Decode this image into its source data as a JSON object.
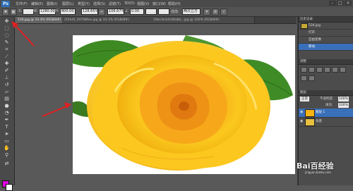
{
  "app": {
    "logo_text": "Ps"
  },
  "menubar": {
    "items": [
      "文件(F)",
      "编辑(E)",
      "图像(I)",
      "图层(L)",
      "类型(Y)",
      "选择(S)",
      "滤镜(T)",
      "3D(D)",
      "视图(V)",
      "窗口(W)",
      "帮助(H)"
    ],
    "window_controls": [
      "–",
      "□",
      "×"
    ]
  },
  "options_bar": {
    "width_label": "W:",
    "width_value": "1280.00",
    "height_label": "H:",
    "height_value": "800.00",
    "scale_x": "128.65%",
    "scale_y": "106.67%",
    "angle": "0.00",
    "interp_label": "插值:",
    "interp_value": "两次立方"
  },
  "tabs": [
    {
      "label": "534.jpg @ 33.3% (RGB/8#)",
      "active": true
    },
    {
      "label": "2t5hd1.29798fee.jpg @ 33.3% (RGB/8#)",
      "active": false
    },
    {
      "label": "19bc3e1d1d6a8a...jpg @ 100% (RGB/8#)",
      "active": false
    }
  ],
  "history_panel": {
    "header": "历史记录",
    "rows": [
      {
        "label": "534.jpg",
        "active": false
      },
      {
        "label": "打开",
        "active": false
      },
      {
        "label": "自由变换",
        "active": false
      },
      {
        "label": "移动",
        "active": true
      }
    ]
  },
  "adjustments_panel": {
    "header": "调整"
  },
  "layers_panel": {
    "header": "图层",
    "mode": "正常",
    "opacity_label": "不透明度:",
    "opacity_value": "100%",
    "fill_label": "填充:",
    "fill_value": "100%",
    "layers": [
      {
        "label": "图层 1",
        "active": true
      },
      {
        "label": "背景",
        "active": false
      }
    ]
  },
  "watermark": {
    "text": "Bai百经验",
    "url": "jingyan.baidu.com"
  },
  "colors": {
    "foreground": "#e000e0",
    "background": "#ffffff",
    "accent": "#3a70b9",
    "annotation_arrow": "#e02020"
  }
}
